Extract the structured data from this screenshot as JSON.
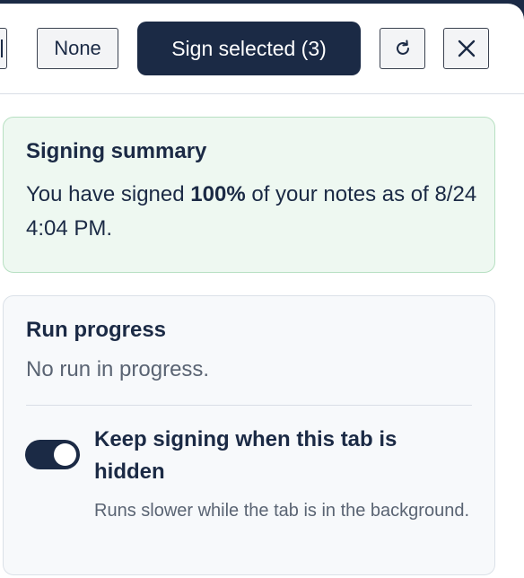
{
  "toolbar": {
    "none_label": "None",
    "sign_selected_label": "Sign selected (3)",
    "refresh_icon": "refresh-icon",
    "close_icon": "close-icon"
  },
  "summary": {
    "title": "Signing summary",
    "text_prefix": "You have signed ",
    "percent": "100%",
    "text_suffix": " of your notes as of 8/24 4:04 PM."
  },
  "progress": {
    "title": "Run progress",
    "status": "No run in progress.",
    "toggle": {
      "label": "Keep signing when this tab is hidden",
      "help": "Runs slower while the tab is in the background.",
      "checked": true
    }
  },
  "colors": {
    "primary": "#1b2a45",
    "summary_bg": "#eef8f1",
    "summary_border": "#b7e0c2",
    "muted_text": "#5a6473"
  }
}
